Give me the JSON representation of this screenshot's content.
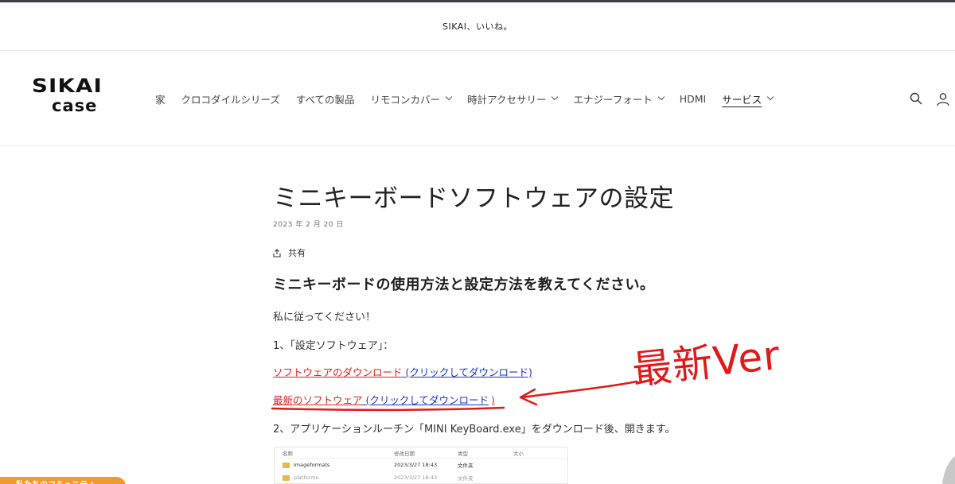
{
  "announcement": {
    "text": "SIKAI、いいね。"
  },
  "header": {
    "logo_line1": "SIKAI",
    "logo_line2": "case",
    "nav": [
      {
        "label": "家",
        "has_dropdown": false
      },
      {
        "label": "クロコダイルシリーズ",
        "has_dropdown": false
      },
      {
        "label": "すべての製品",
        "has_dropdown": false
      },
      {
        "label": "リモコンカバー",
        "has_dropdown": true
      },
      {
        "label": "時計アクセサリー",
        "has_dropdown": true
      },
      {
        "label": "エナジーフォート",
        "has_dropdown": true
      },
      {
        "label": "HDMI",
        "has_dropdown": false
      },
      {
        "label": "サービス",
        "has_dropdown": true,
        "active": true
      }
    ],
    "icons": [
      "search-icon",
      "account-icon"
    ]
  },
  "article": {
    "title": "ミニキーボードソフトウェアの設定",
    "date": "2023 年 2 月 20 日",
    "share_label": "共有",
    "heading": "ミニキーボードの使用方法と設定方法を教えてください。",
    "intro": "私に従ってください！",
    "step1": "1、「設定ソフトウェア」：",
    "link1_red": "ソフトウェアのダウンロード",
    "link1_blue": " (クリックしてダウンロード)",
    "link2_red": "最新のソフトウェア",
    "link2_blue": " (クリックしてダウンロード",
    "link2_close": ")",
    "step2": "2、アプリケーションルーチン「MINI KeyBoard.exe」をダウンロード後、開きます。",
    "annotation": "最新Ver"
  },
  "explorer": {
    "headers": [
      "名称",
      "修改日期",
      "类型",
      "大小"
    ],
    "rows": [
      {
        "name": "imageformats",
        "date": "2023/3/27 18:43",
        "type": "文件夹"
      },
      {
        "name": "platforms",
        "date": "2023/3/27 18:43",
        "type": "文件夹"
      }
    ]
  },
  "community": {
    "label": "私たちのコミュニティ"
  },
  "colors": {
    "accent_red": "#e02020",
    "link_blue": "#1b35c8",
    "community_orange": "#ef9a2e"
  }
}
